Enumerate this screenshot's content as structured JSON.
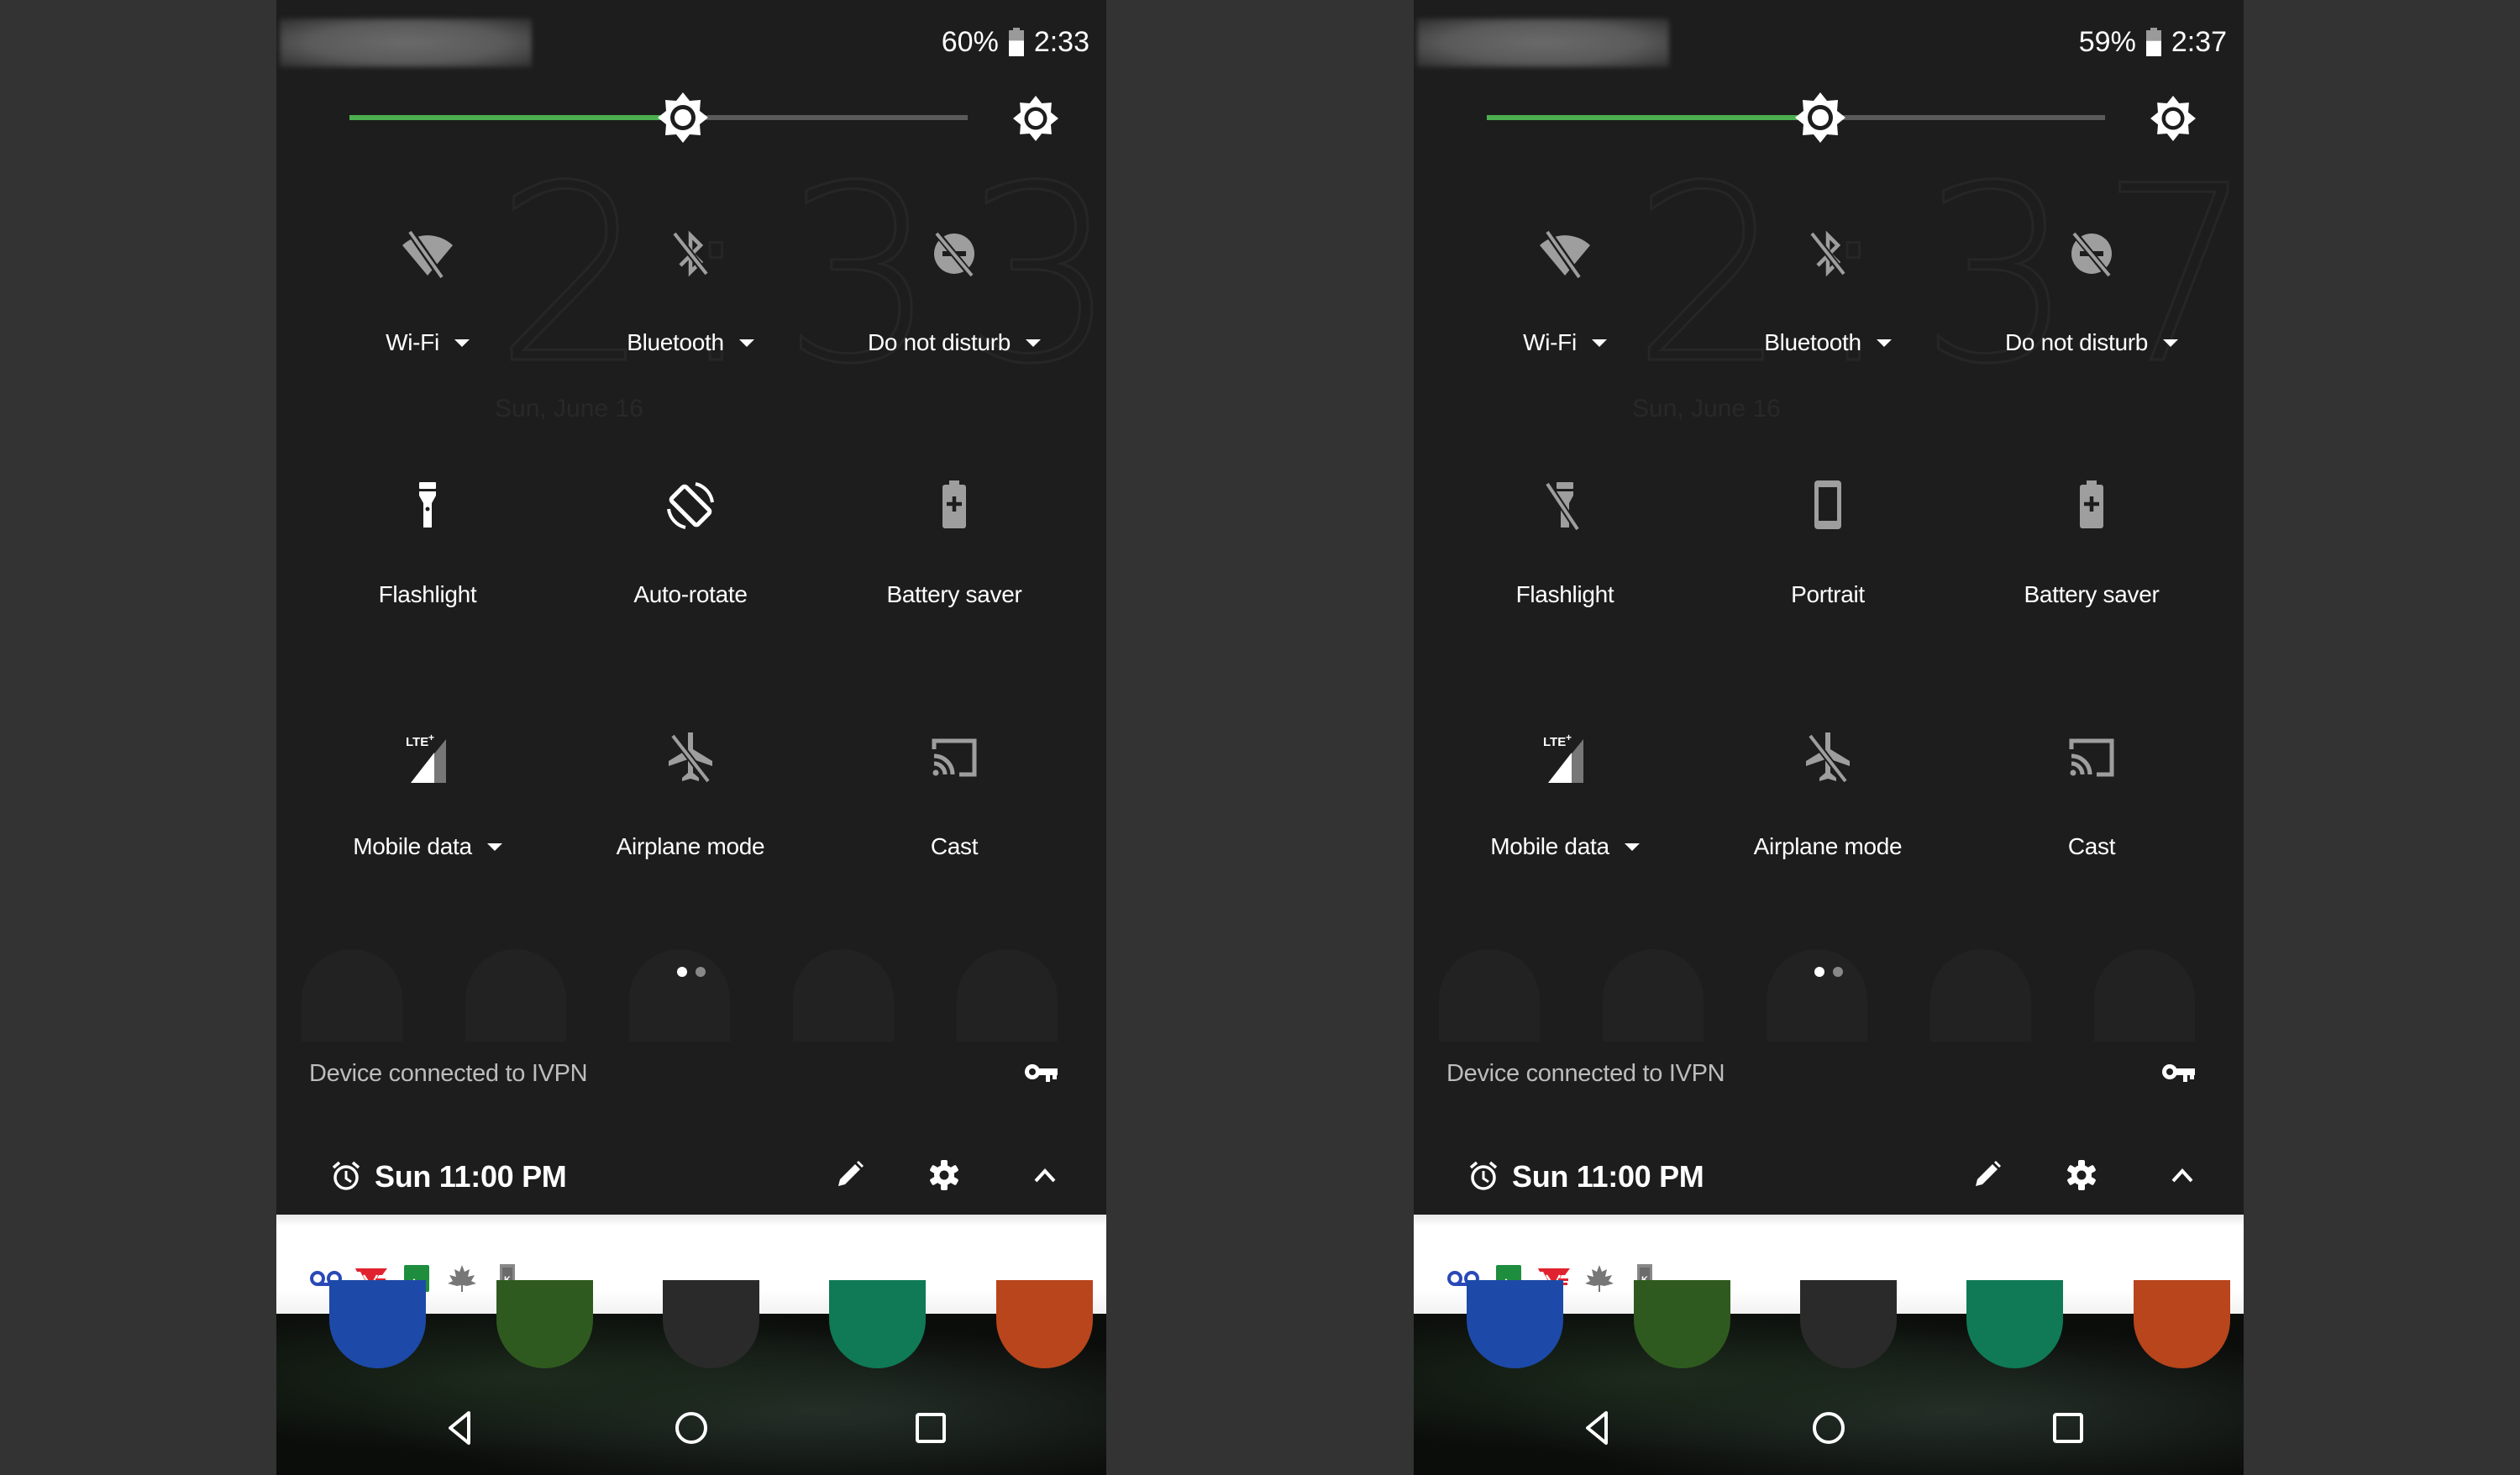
{
  "background_color": "#333333",
  "panels": [
    {
      "id": "left",
      "status_bar": {
        "battery_percent": "60%",
        "battery_level": 0.6,
        "time": "2:33"
      },
      "brightness": {
        "level": 0.54,
        "accent_color": "#4caf50"
      },
      "background_clock": "2:33",
      "background_date": "Sun, June 16",
      "tiles": [
        {
          "label": "Wi-Fi",
          "icon": "wifi-off-icon",
          "has_dropdown": true,
          "active": false
        },
        {
          "label": "Bluetooth",
          "icon": "bluetooth-disabled-icon",
          "has_dropdown": true,
          "active": false
        },
        {
          "label": "Do not disturb",
          "icon": "do-not-disturb-off-icon",
          "has_dropdown": true,
          "active": false
        },
        {
          "label": "Flashlight",
          "icon": "flashlight-icon",
          "has_dropdown": false,
          "active": true
        },
        {
          "label": "Auto-rotate",
          "icon": "auto-rotate-icon",
          "has_dropdown": false,
          "active": true
        },
        {
          "label": "Battery saver",
          "icon": "battery-saver-icon",
          "has_dropdown": false,
          "active": false
        },
        {
          "label": "Mobile data",
          "icon": "signal-lte-icon",
          "network_type": "LTE+",
          "has_dropdown": true,
          "active": true
        },
        {
          "label": "Airplane mode",
          "icon": "airplane-off-icon",
          "has_dropdown": false,
          "active": false
        },
        {
          "label": "Cast",
          "icon": "cast-icon",
          "has_dropdown": false,
          "active": false
        }
      ],
      "page_indicator": {
        "pages": 2,
        "current": 1
      },
      "vpn": {
        "text": "Device connected to IVPN",
        "icon": "vpn-key-icon"
      },
      "footer": {
        "alarm_text": "Sun 11:00 PM",
        "alarm_icon": "alarm-icon",
        "edit_icon": "pencil-icon",
        "settings_icon": "gear-icon",
        "collapse_icon": "chevron-up-icon"
      },
      "notification_icons": [
        "voicemail-icon",
        "vf-app-icon",
        "gallery-icon",
        "maple-leaf-icon",
        "k-app-icon"
      ],
      "nav": {
        "back": "back-icon",
        "home": "home-icon",
        "recents": "recents-icon"
      }
    },
    {
      "id": "right",
      "status_bar": {
        "battery_percent": "59%",
        "battery_level": 0.59,
        "time": "2:37"
      },
      "brightness": {
        "level": 0.54,
        "accent_color": "#4caf50"
      },
      "background_clock": "2:37",
      "background_date": "Sun, June 16",
      "tiles": [
        {
          "label": "Wi-Fi",
          "icon": "wifi-off-icon",
          "has_dropdown": true,
          "active": false
        },
        {
          "label": "Bluetooth",
          "icon": "bluetooth-disabled-icon",
          "has_dropdown": true,
          "active": false
        },
        {
          "label": "Do not disturb",
          "icon": "do-not-disturb-off-icon",
          "has_dropdown": true,
          "active": false
        },
        {
          "label": "Flashlight",
          "icon": "flashlight-off-icon",
          "has_dropdown": false,
          "active": false
        },
        {
          "label": "Portrait",
          "icon": "portrait-lock-icon",
          "has_dropdown": false,
          "active": false
        },
        {
          "label": "Battery saver",
          "icon": "battery-saver-icon",
          "has_dropdown": false,
          "active": false
        },
        {
          "label": "Mobile data",
          "icon": "signal-lte-icon",
          "network_type": "LTE+",
          "has_dropdown": true,
          "active": true
        },
        {
          "label": "Airplane mode",
          "icon": "airplane-off-icon",
          "has_dropdown": false,
          "active": false
        },
        {
          "label": "Cast",
          "icon": "cast-icon",
          "has_dropdown": false,
          "active": false
        }
      ],
      "page_indicator": {
        "pages": 2,
        "current": 1
      },
      "vpn": {
        "text": "Device connected to IVPN",
        "icon": "vpn-key-icon"
      },
      "footer": {
        "alarm_text": "Sun 11:00 PM",
        "alarm_icon": "alarm-icon",
        "edit_icon": "pencil-icon",
        "settings_icon": "gear-icon",
        "collapse_icon": "chevron-up-icon"
      },
      "notification_icons": [
        "voicemail-icon",
        "gallery-icon",
        "vf-app-icon",
        "maple-leaf-icon",
        "k-app-icon"
      ],
      "nav": {
        "back": "back-icon",
        "home": "home-icon",
        "recents": "recents-icon"
      }
    }
  ]
}
